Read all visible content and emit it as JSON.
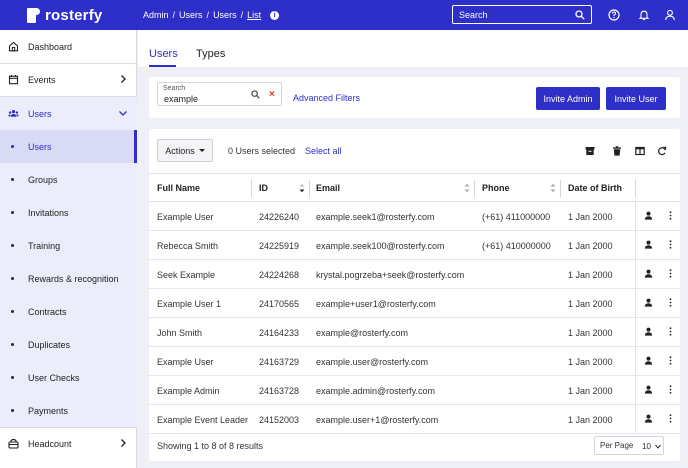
{
  "app": {
    "logo_text": "rosterfy"
  },
  "topbar": {
    "breadcrumbs": [
      "Admin",
      "Users",
      "Users",
      "List"
    ],
    "search_placeholder": "Search",
    "icons": [
      "help-icon",
      "bell-icon",
      "user-icon"
    ]
  },
  "sidebar": {
    "items": [
      {
        "label": "Dashboard",
        "icon": "home-icon"
      },
      {
        "label": "Events",
        "icon": "calendar-icon"
      },
      {
        "label": "Users",
        "icon": "users-icon"
      },
      {
        "label": "Headcount",
        "icon": "headcount-icon"
      }
    ],
    "users_sub": [
      "Users",
      "Groups",
      "Invitations",
      "Training",
      "Rewards & recognition",
      "Contracts",
      "Duplicates",
      "User Checks",
      "Payments"
    ]
  },
  "tabs": [
    {
      "label": "Users"
    },
    {
      "label": "Types"
    }
  ],
  "filter": {
    "search_label": "Search",
    "search_value": "example",
    "advanced_filters": "Advanced Filters",
    "invite_admin": "Invite Admin",
    "invite_user": "Invite User"
  },
  "table": {
    "actions_label": "Actions",
    "selected_text": "0 Users selected",
    "select_all": "Select all",
    "columns": [
      "Full Name",
      "ID",
      "Email",
      "Phone",
      "Date of Birth"
    ],
    "rows": [
      {
        "name": "Example User",
        "id": "24226240",
        "email": "example.seek1@rosterfy.com",
        "phone": "(+61) 411000000",
        "dob": "1 Jan 2000"
      },
      {
        "name": "Rebecca Smith",
        "id": "24225919",
        "email": "example.seek100@rosterfy.com",
        "phone": "(+61) 410000000",
        "dob": "1 Jan 2000"
      },
      {
        "name": "Seek Example",
        "id": "24224268",
        "email": "krystal.pogrzeba+seek@rosterfy.com",
        "phone": "",
        "dob": "1 Jan 2000"
      },
      {
        "name": "Example User 1",
        "id": "24170565",
        "email": "example+user1@rosterfy.com",
        "phone": "",
        "dob": "1 Jan 2000"
      },
      {
        "name": "John Smith",
        "id": "24164233",
        "email": "example@rosterfy.com",
        "phone": "",
        "dob": "1 Jan 2000"
      },
      {
        "name": "Example User",
        "id": "24163729",
        "email": "example.user@rosterfy.com",
        "phone": "",
        "dob": "1 Jan 2000"
      },
      {
        "name": "Example Admin",
        "id": "24163728",
        "email": "example.admin@rosterfy.com",
        "phone": "",
        "dob": "1 Jan 2000"
      },
      {
        "name": "Example Event Leader",
        "id": "24152003",
        "email": "example.user+1@rosterfy.com",
        "phone": "",
        "dob": "1 Jan 2000"
      }
    ],
    "footer_text": "Showing 1 to 8 of 8 results",
    "per_page_label": "Per Page",
    "per_page_value": "10"
  },
  "colors": {
    "brand": "#2e2ec8",
    "danger": "#e53030"
  }
}
